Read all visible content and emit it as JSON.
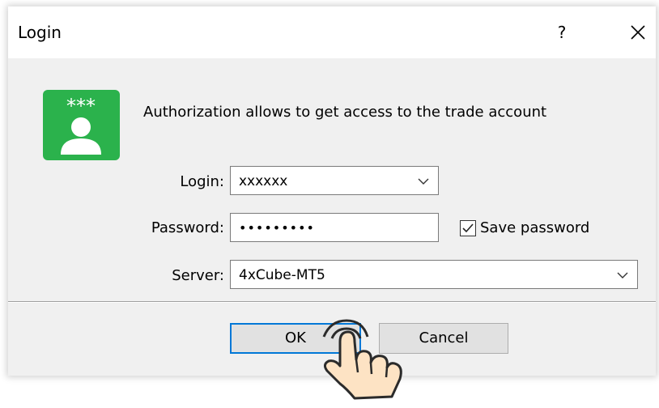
{
  "window": {
    "title": "Login",
    "help_label": "?"
  },
  "header": {
    "description": "Authorization allows to get access to the trade account",
    "icon_text": "***"
  },
  "form": {
    "login_label": "Login:",
    "login_value": "xxxxxx",
    "password_label": "Password:",
    "password_value": "•••••••••",
    "save_password_label": "Save password",
    "save_password_checked": true,
    "server_label": "Server:",
    "server_value": "4xCube-MT5"
  },
  "buttons": {
    "ok_label": "OK",
    "cancel_label": "Cancel"
  },
  "icons": {
    "app": "user-key-icon",
    "close": "close-icon",
    "chevron": "chevron-down-icon",
    "check": "checkmark-icon",
    "cursor": "hand-pointer-icon"
  },
  "colors": {
    "icon_green": "#2bb24c",
    "focus_blue": "#0078d7",
    "hand_fill": "#fde3c4",
    "hand_stroke": "#2b2b2b"
  }
}
